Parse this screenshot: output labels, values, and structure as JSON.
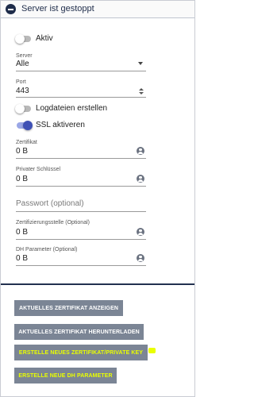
{
  "header": {
    "title": "Server ist gestoppt"
  },
  "aktiv": {
    "label": "Aktiv",
    "enabled": false
  },
  "server": {
    "label": "Server",
    "value": "Alle"
  },
  "port": {
    "label": "Port",
    "value": "443"
  },
  "logdateien": {
    "label": "Logdateien erstellen",
    "enabled": false
  },
  "ssl": {
    "label": "SSL aktiveren",
    "enabled": true
  },
  "zertifikat": {
    "label": "Zertifikat",
    "value": "0 B"
  },
  "privater_schluessel": {
    "label": "Privater Schlüssel",
    "value": "0 B"
  },
  "passwort": {
    "placeholder": "Passwort (optional)"
  },
  "zertifizierungsstelle": {
    "label": "Zertifizierungsstelle (Optional)",
    "value": "0 B"
  },
  "dh_parameter": {
    "label": "DH Parameter (Optional)",
    "value": "0 B"
  },
  "buttons": {
    "show_cert": "AKTUELLES ZERTIFIKAT ANZEIGEN",
    "download_cert": "AKTUELLES ZERTIFIKAT HERUNTERLADEN",
    "new_cert": "ERSTELLE NEUES ZERTIFIKAT/PRIVATE KEY",
    "new_dh": "ERSTELLE NEUE DH PARAMETER"
  },
  "colors": {
    "primary": "#3f51b5",
    "header_dark": "#1e2c4a",
    "button_bg": "#7b8595",
    "highlight": "#eaff00"
  }
}
